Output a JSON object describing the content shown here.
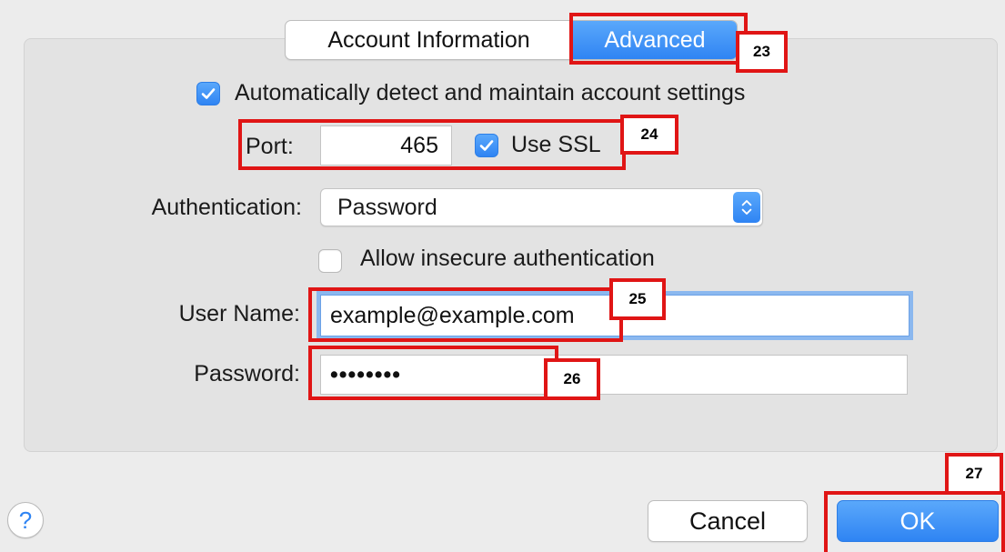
{
  "tabs": {
    "account_information": "Account Information",
    "advanced": "Advanced"
  },
  "auto_detect": {
    "label": "Automatically detect and maintain account settings",
    "checked": true
  },
  "port": {
    "label": "Port:",
    "value": "465"
  },
  "use_ssl": {
    "label": "Use SSL",
    "checked": true
  },
  "authentication": {
    "label": "Authentication:",
    "value": "Password"
  },
  "allow_insecure": {
    "label": "Allow insecure authentication",
    "checked": false
  },
  "user_name": {
    "label": "User Name:",
    "value": "example@example.com"
  },
  "password": {
    "label": "Password:",
    "value": "••••••••"
  },
  "buttons": {
    "help": "?",
    "cancel": "Cancel",
    "ok": "OK"
  },
  "annotations": {
    "n23": "23",
    "n24": "24",
    "n25": "25",
    "n26": "26",
    "n27": "27"
  },
  "colors": {
    "accent": "#2f84f3",
    "annotation": "#e01515",
    "focus_ring": "#8bb8ef"
  }
}
